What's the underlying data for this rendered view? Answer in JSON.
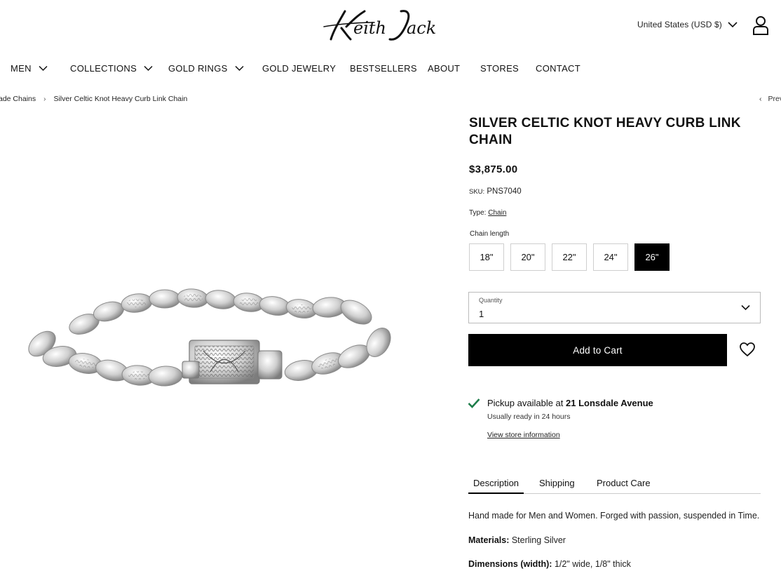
{
  "header": {
    "logo_text": "Keith Jack",
    "currency": "United States (USD $)",
    "icons": {
      "currency_dropdown": "chevron-down-icon",
      "account": "user-icon"
    }
  },
  "nav": {
    "items": [
      {
        "label": "MEN",
        "has_dropdown": true
      },
      {
        "label": "COLLECTIONS",
        "has_dropdown": true
      },
      {
        "label": "GOLD RINGS",
        "has_dropdown": true
      },
      {
        "label": "GOLD JEWELRY",
        "has_dropdown": false
      },
      {
        "label": "BESTSELLERS",
        "has_dropdown": false
      },
      {
        "label": "ABOUT",
        "has_dropdown": false
      },
      {
        "label": "STORES",
        "has_dropdown": false
      },
      {
        "label": "CONTACT",
        "has_dropdown": false
      }
    ]
  },
  "breadcrumb": {
    "items": [
      "ade Chains",
      "Silver Celtic Knot Heavy Curb Link Chain"
    ],
    "prev": "Prev"
  },
  "product": {
    "title": "SILVER CELTIC KNOT HEAVY CURB LINK CHAIN",
    "price": "$3,875.00",
    "sku_label": "SKU:",
    "sku": "PNS7040",
    "type_label": "Type:",
    "type_value": "Chain",
    "chain_length_label": "Chain length",
    "lengths": [
      "18\"",
      "20\"",
      "22\"",
      "24\"",
      "26\""
    ],
    "selected_length": "26\"",
    "quantity_label": "Quantity",
    "quantity": "1",
    "add_to_cart": "Add to Cart",
    "wishlist_icon": "heart-icon"
  },
  "pickup": {
    "text_prefix": "Pickup available at ",
    "store": "21 Lonsdale Avenue",
    "ready": "Usually ready in 24 hours",
    "link": "View store information"
  },
  "tabs": {
    "items": [
      "Description",
      "Shipping",
      "Product Care"
    ],
    "active": "Description"
  },
  "description": {
    "line1": "Hand made for Men and Women. Forged with passion, suspended in Time.",
    "materials_label": "Materials:",
    "materials": " Sterling Silver",
    "dimensions_label": "Dimensions (width):",
    "dimensions": " 1/2\" wide, 1/8\" thick"
  },
  "colors": {
    "accent": "#000000",
    "check": "#1e7d4a"
  }
}
